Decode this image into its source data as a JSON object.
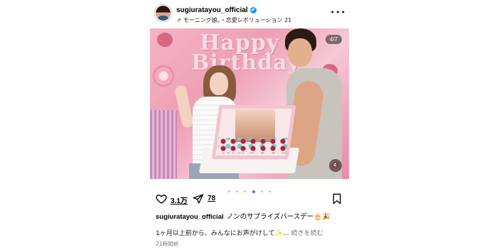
{
  "header": {
    "username": "sugiuratayou_official",
    "verified_icon": "✔",
    "subline_arrow": "↗",
    "subline_text": "モーニング娘。・恋愛レボリューション 21",
    "more_icon": "•••"
  },
  "photo": {
    "banner_line1": "Happy",
    "banner_line2": "Birthday",
    "counter": "4/7",
    "mute_icon": "🔇"
  },
  "carousel": {
    "total": 6,
    "active_index": 3
  },
  "actions": {
    "likes": "3.1万",
    "shares": "78"
  },
  "caption": {
    "username": "sugiuratayou_official",
    "text": "ノンのサプライズバースデー🎂🎉",
    "line2": "1ヶ月以上前から、みんなにお声がけして✨…",
    "read_more": "続きを読む",
    "time": "21時間前"
  },
  "colors": {
    "accent": "#2f7df6",
    "verified": "#1d9bf0",
    "muted_text": "#777777"
  }
}
